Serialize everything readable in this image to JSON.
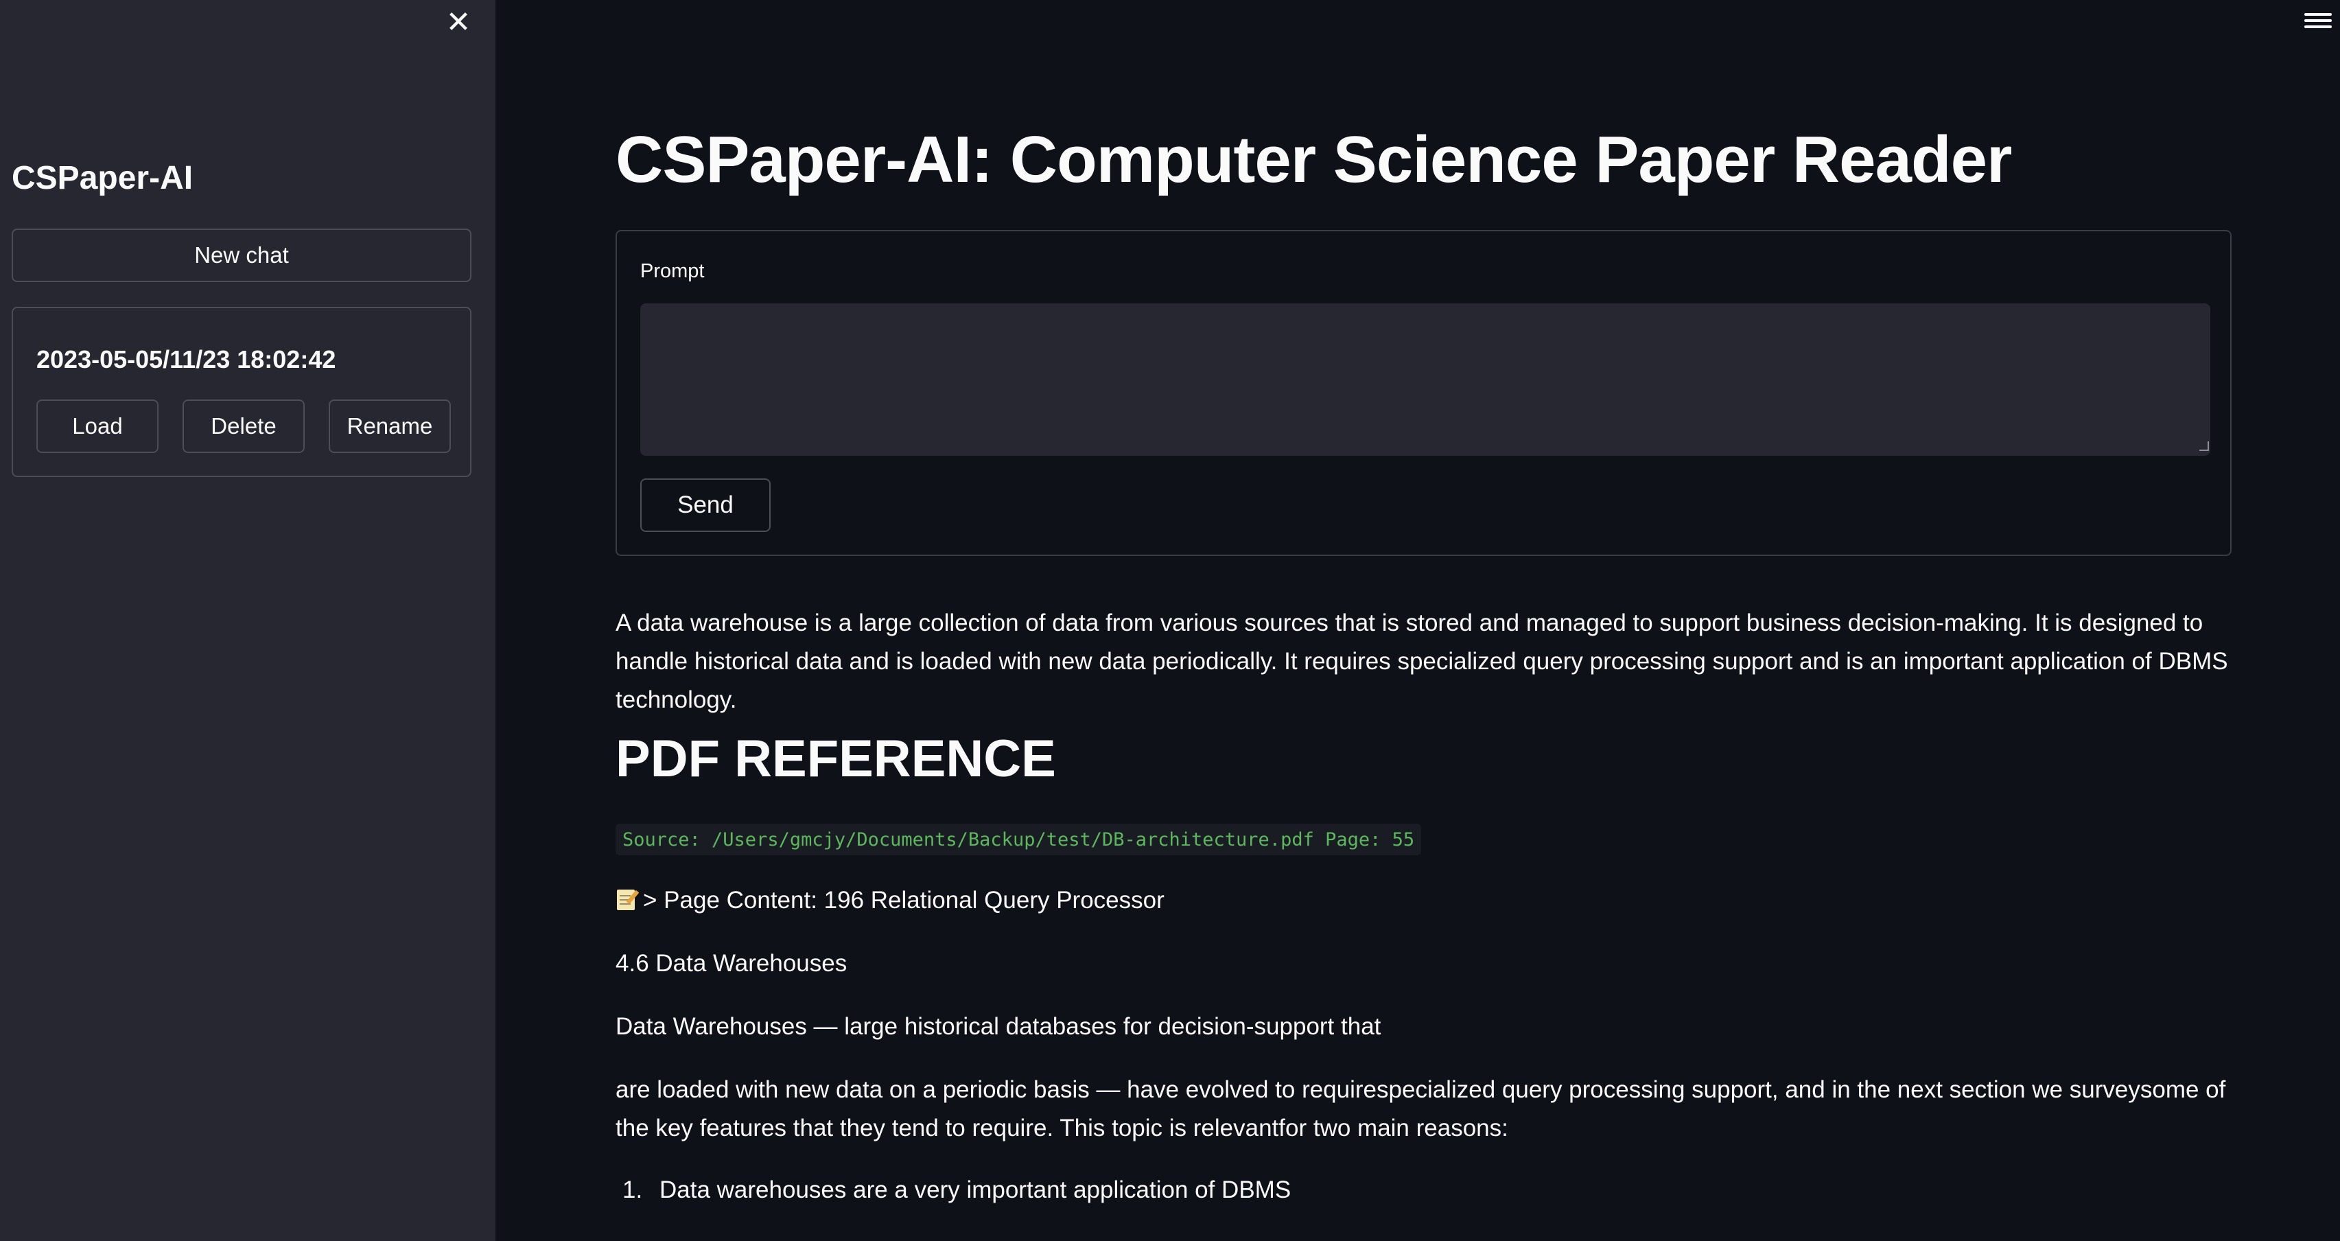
{
  "sidebar": {
    "title": "CSPaper-AI",
    "new_chat_label": "New chat",
    "history": {
      "timestamp": "2023-05-05/11/23 18:02:42",
      "load_label": "Load",
      "delete_label": "Delete",
      "rename_label": "Rename"
    }
  },
  "main": {
    "title": "CSPaper-AI: Computer Science Paper Reader",
    "prompt_label": "Prompt",
    "prompt_value": "",
    "send_label": "Send",
    "answer": "A data warehouse is a large collection of data from various sources that is stored and managed to support business decision-making. It is designed to handle historical data and is loaded with new data periodically. It requires specialized query processing support and is an important application of DBMS technology.",
    "reference_heading": "PDF REFERENCE",
    "source": "Source: /Users/gmcjy/Documents/Backup/test/DB-architecture.pdf Page: 55",
    "page_content": "> Page Content: 196 Relational Query Processor",
    "section_line": "4.6 Data Warehouses",
    "paragraph_1": "Data Warehouses — large historical databases for decision-support that",
    "paragraph_2": "are loaded with new data on a periodic basis — have evolved to requirespecialized query processing support, and in the next section we surveysome of the key features that they tend to require. This topic is relevantfor two main reasons:",
    "list_item_1_number": "1.",
    "list_item_1": "Data warehouses are a very important application of DBMS"
  },
  "icons": {
    "close": "close-icon",
    "menu": "hamburger-menu-icon",
    "memo": "memo-icon"
  },
  "colors": {
    "background": "#0e1117",
    "sidebar": "#262730",
    "code_text": "#5cb85c"
  }
}
